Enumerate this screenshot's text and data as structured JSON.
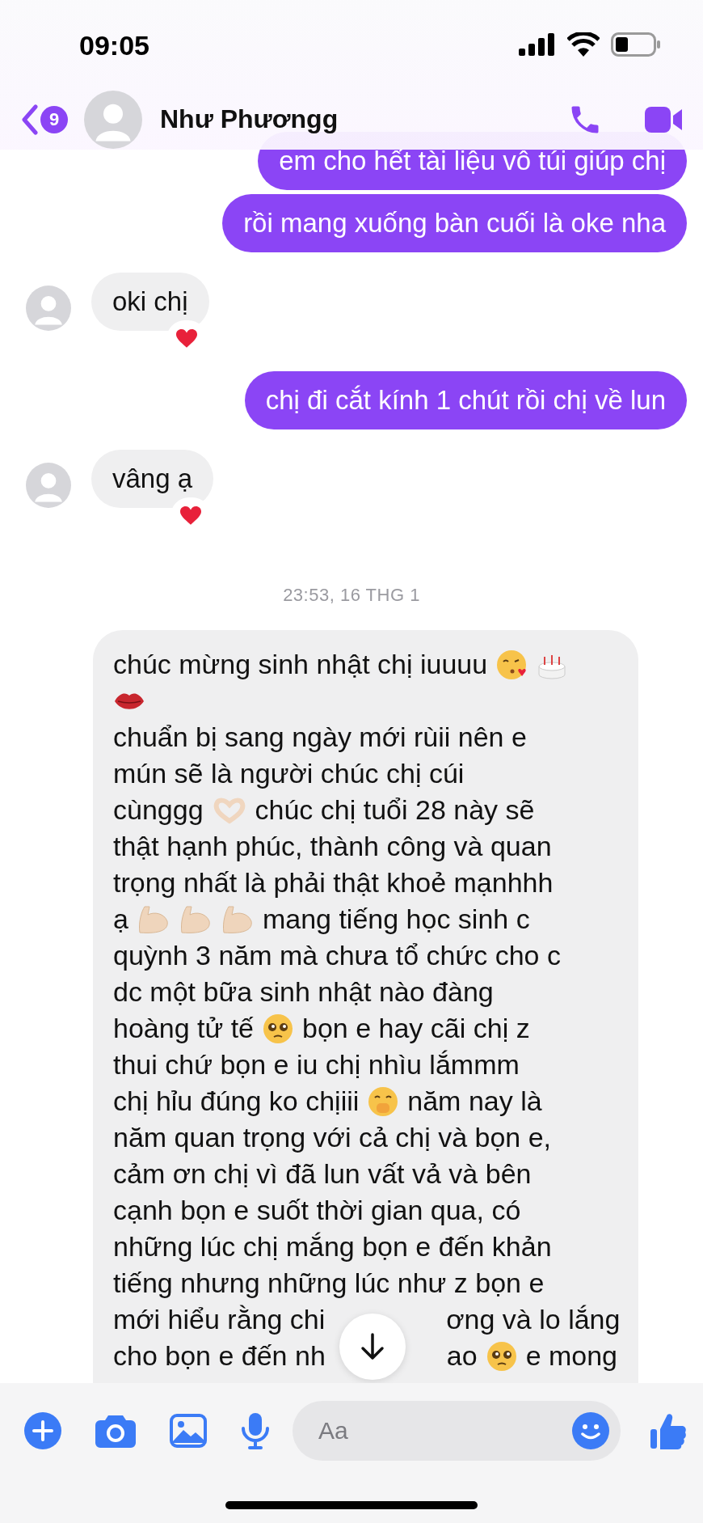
{
  "status_bar": {
    "time": "09:05"
  },
  "header": {
    "back_badge": "9",
    "name": "Như Phươngg"
  },
  "messages": [
    {
      "kind": "outgoing",
      "text": "em cho hết tài liệu vô túi giúp chị"
    },
    {
      "kind": "outgoing",
      "text": "rồi mang xuống bàn cuối là oke nha"
    },
    {
      "kind": "incoming",
      "text": "oki chị",
      "reacted": true
    },
    {
      "kind": "outgoing",
      "text": "chị đi cắt kính 1 chút rồi chị về lun"
    },
    {
      "kind": "incoming",
      "text": "vâng ạ",
      "reacted": true
    },
    {
      "kind": "timestamp",
      "text": "23:53, 16 THG 1"
    },
    {
      "kind": "incoming_long",
      "lines": [
        [
          {
            "kind": "text",
            "text": "chúc mừng sinh nhật chị iuuuu"
          },
          {
            "kind": "kiss_face"
          },
          {
            "kind": "cake"
          }
        ],
        [
          {
            "kind": "lips"
          }
        ],
        [
          {
            "kind": "text",
            "text": "chuẩn bị sang ngày mới rùii nên e"
          }
        ],
        [
          {
            "kind": "text",
            "text": "mún sẽ là người chúc chị cúi"
          }
        ],
        [
          {
            "kind": "text",
            "text": "cùnggg"
          },
          {
            "kind": "heart_hands"
          },
          {
            "kind": "text",
            "text": "chúc chị tuổi 28 này sẽ"
          }
        ],
        [
          {
            "kind": "text",
            "text": "thật hạnh phúc, thành công và quan"
          }
        ],
        [
          {
            "kind": "text",
            "text": "trọng nhất là phải thật khoẻ mạnhhh"
          }
        ],
        [
          {
            "kind": "text",
            "text": "ạ"
          },
          {
            "kind": "arm"
          },
          {
            "kind": "arm"
          },
          {
            "kind": "arm"
          },
          {
            "kind": "text",
            "text": "mang tiếng học sinh c"
          }
        ],
        [
          {
            "kind": "text",
            "text": "quỳnh 3 năm mà chưa tổ chức cho c"
          }
        ],
        [
          {
            "kind": "text",
            "text": "dc một bữa sinh nhật nào đàng"
          }
        ],
        [
          {
            "kind": "text",
            "text": "hoàng tử tế"
          },
          {
            "kind": "pleading_face"
          },
          {
            "kind": "text",
            "text": "bọn e hay cãi chị z"
          }
        ],
        [
          {
            "kind": "text",
            "text": "thui chứ bọn e iu chị nhìu lắmmm"
          }
        ],
        [
          {
            "kind": "text",
            "text": "chị hỉu đúng ko chịiii"
          },
          {
            "kind": "hand_mouth_face"
          },
          {
            "kind": "text",
            "text": "năm nay là"
          }
        ],
        [
          {
            "kind": "text",
            "text": "năm quan trọng với cả chị và bọn e,"
          }
        ],
        [
          {
            "kind": "text",
            "text": "cảm ơn chị vì đã lun vất vả và bên"
          }
        ],
        [
          {
            "kind": "text",
            "text": "cạnh bọn e suốt thời gian qua, có"
          }
        ],
        [
          {
            "kind": "text",
            "text": "những lúc chị mắng bọn e đến khản"
          }
        ],
        [
          {
            "kind": "text",
            "text": "tiếng nhưng những lúc như z bọn e"
          }
        ],
        [
          {
            "kind": "text",
            "text": "mới hiểu rằng chi"
          },
          {
            "kind": "covered"
          },
          {
            "kind": "text",
            "text": "ơng và lo lắng"
          }
        ],
        [
          {
            "kind": "text",
            "text": "cho bọn e đến nh"
          },
          {
            "kind": "covered"
          },
          {
            "kind": "text",
            "text": "ao"
          },
          {
            "kind": "pleading_face"
          },
          {
            "kind": "text",
            "text": "e mong"
          }
        ]
      ]
    }
  ],
  "composer": {
    "placeholder": "Aa"
  }
}
